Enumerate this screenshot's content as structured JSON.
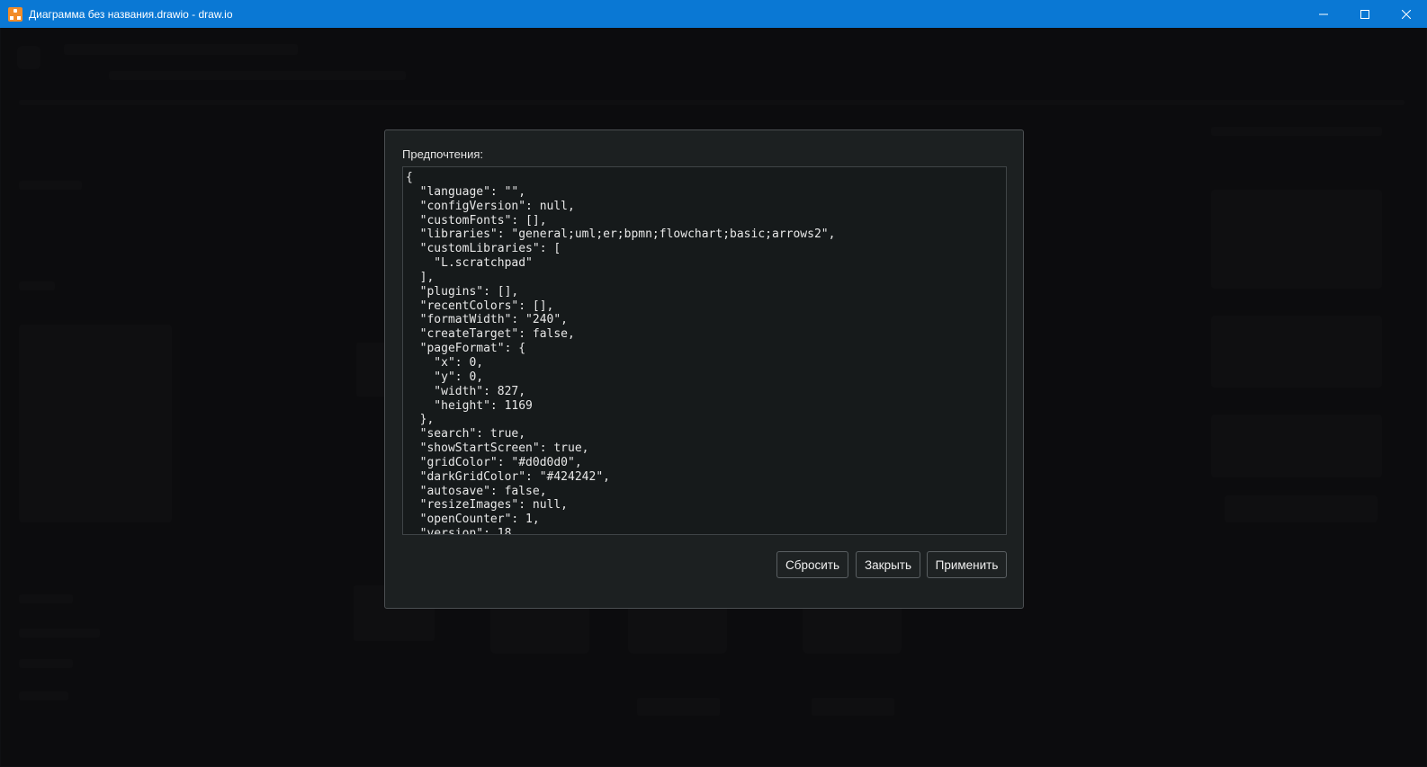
{
  "window": {
    "title": "Диаграмма без названия.drawio - draw.io",
    "controls": [
      "minimize",
      "maximize",
      "close"
    ]
  },
  "dialog": {
    "label": "Предпочтения:",
    "content": "{\n  \"language\": \"\",\n  \"configVersion\": null,\n  \"customFonts\": [],\n  \"libraries\": \"general;uml;er;bpmn;flowchart;basic;arrows2\",\n  \"customLibraries\": [\n    \"L.scratchpad\"\n  ],\n  \"plugins\": [],\n  \"recentColors\": [],\n  \"formatWidth\": \"240\",\n  \"createTarget\": false,\n  \"pageFormat\": {\n    \"x\": 0,\n    \"y\": 0,\n    \"width\": 827,\n    \"height\": 1169\n  },\n  \"search\": true,\n  \"showStartScreen\": true,\n  \"gridColor\": \"#d0d0d0\",\n  \"darkGridColor\": \"#424242\",\n  \"autosave\": false,\n  \"resizeImages\": null,\n  \"openCounter\": 1,\n  \"version\": 18,",
    "buttons": {
      "reset": "Сбросить",
      "close": "Закрыть",
      "apply": "Применить"
    }
  },
  "colors": {
    "titlebar": "#0a78d4",
    "dialog_bg": "#1c2021",
    "app_bg": "#1b1b1f"
  },
  "icons": {
    "app": "drawio-logo-icon",
    "minimize": "minimize-icon",
    "maximize": "maximize-icon",
    "close": "close-icon"
  }
}
